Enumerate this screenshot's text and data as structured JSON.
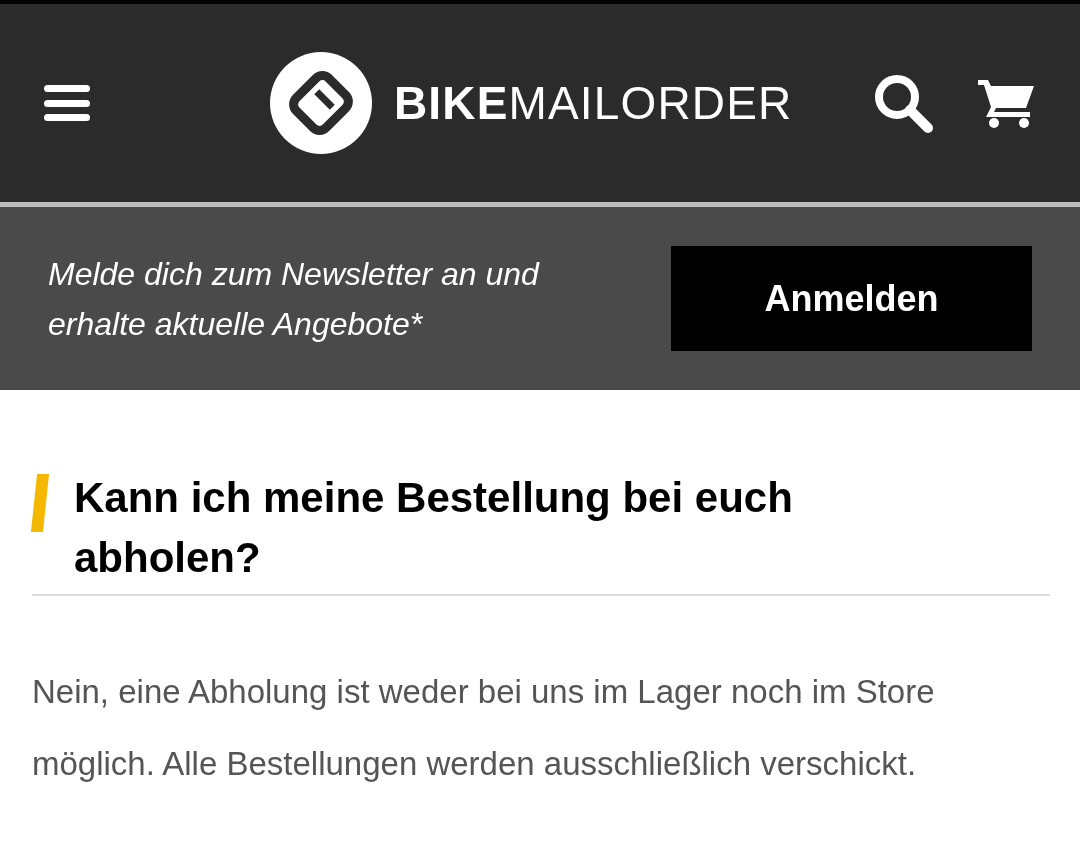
{
  "header": {
    "brand": {
      "bold": "BIKE",
      "light": "MAILORDER"
    }
  },
  "newsletter": {
    "text": "Melde dich zum Newsletter an und erhalte aktuelle Angebote*",
    "button": "Anmelden"
  },
  "faq": {
    "question": "Kann ich meine Bestellung bei euch abholen?",
    "answer": "Nein, eine Abholung ist weder bei uns im Lager noch im Store möglich. Alle Bestellungen werden ausschließlich verschickt."
  }
}
